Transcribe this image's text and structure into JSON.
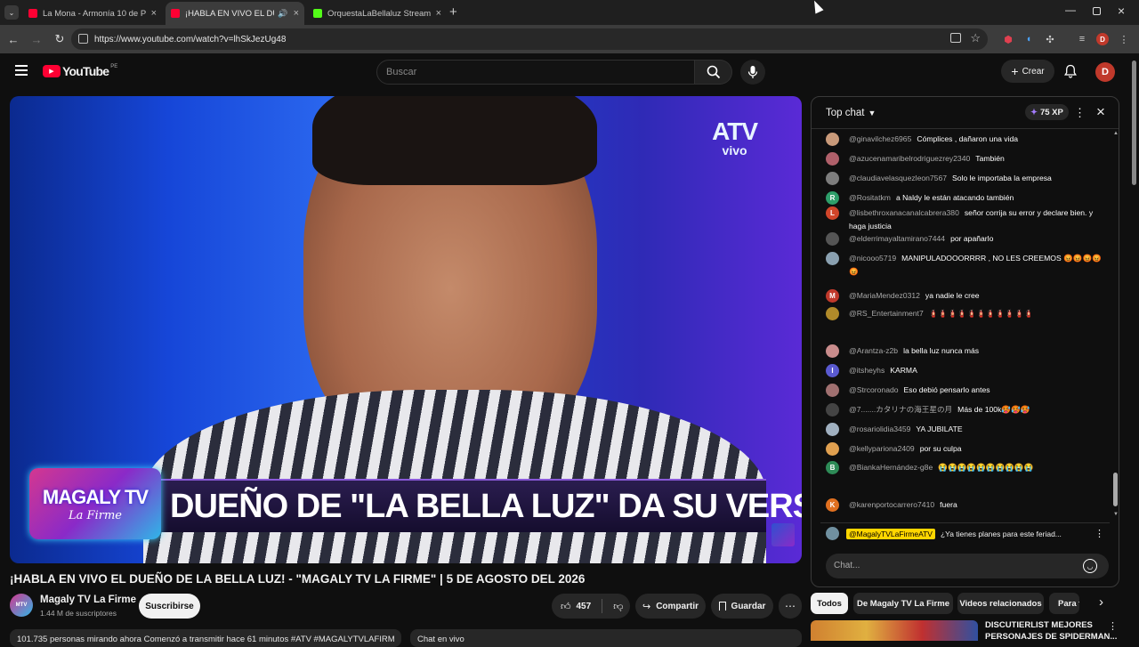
{
  "browser": {
    "tabs": [
      {
        "title": "La Mona - Armonía 10 de Piura",
        "icon_color": "#ff0033",
        "active": false
      },
      {
        "title": "¡HABLA EN VIVO EL DUEÑO",
        "icon_color": "#ff0033",
        "active": true
      },
      {
        "title": "OrquestaLaBellaluz Stream - W",
        "icon_color": "#53fc18",
        "active": false
      }
    ],
    "url": "https://www.youtube.com/watch?v=lhSkJezUg48",
    "profile_initial": "D"
  },
  "youtube": {
    "logo_text": "YouTube",
    "logo_country": "PE",
    "search_placeholder": "Buscar",
    "create_label": "Crear",
    "user_initial": "D"
  },
  "video": {
    "channel_logo": {
      "line1": "ATV",
      "line2": "vivo"
    },
    "show_badge": {
      "line1": "MAGALY TV",
      "line2": "La Firme"
    },
    "lower_third": "DUEÑO DE \"LA BELLA LUZ\" DA SU VERSIÓN",
    "title": "¡HABLA EN VIVO EL DUEÑO DE LA BELLA LUZ! - \"MAGALY TV LA FIRME\" | 5 DE AGOSTO DEL 2026",
    "channel_name": "Magaly TV La Firme",
    "subscribers": "1.44 M de suscriptores",
    "subscribe_label": "Suscribirse",
    "likes": "457",
    "share_label": "Compartir",
    "save_label": "Guardar",
    "description_snippet": "101.735 personas mirando ahora  Comenzó a transmitir hace 61 minutos  #ATV #MAGALYTVLAFIRM",
    "chat_replay_label": "Chat en vivo"
  },
  "chat": {
    "mode": "Top chat",
    "xp": "75 XP",
    "messages": [
      {
        "author": "@ginavilchez6965",
        "text": "Cómplices , dañaron una vida",
        "color": "#c99a7a",
        "initial": ""
      },
      {
        "author": "@azucenamaribelrodriguezrey2340",
        "text": "También",
        "color": "#b0606a",
        "initial": ""
      },
      {
        "author": "@claudiavelasquezleon7567",
        "text": "Solo le importaba la empresa",
        "color": "#7d7d7d",
        "initial": ""
      },
      {
        "author": "@Rositatkm",
        "text": "a Naldy le están atacando también",
        "color": "#2e9e6a",
        "initial": "R"
      },
      {
        "author": "@lisbethroxanacanalcabrera380",
        "text": "señor corrija su error y declare bien. y haga justicia",
        "color": "#d0452a",
        "initial": "L"
      },
      {
        "author": "@elderrimayaltamirano7444",
        "text": "por apañarlo",
        "color": "#555555",
        "initial": ""
      },
      {
        "author": "@nicooo5719",
        "text": "MANIPULADOOORRRR , NO LES CREEMOS 😡😡😡😡😡",
        "color": "#8aa0b0",
        "initial": ""
      },
      {
        "author": "@MariaMendez0312",
        "text": "ya nadie le cree",
        "color": "#c0392b",
        "initial": "M"
      },
      {
        "author": "@RS_Entertainment7",
        "text": "🧯🧯🧯🧯🧯🧯🧯🧯🧯🧯🧯",
        "color": "#b08a2a",
        "initial": ""
      },
      {
        "author": "@Arantza-z2b",
        "text": "la bella luz nunca más",
        "color": "#c98c8c",
        "initial": ""
      },
      {
        "author": "@itsheyhs",
        "text": "KARMA",
        "color": "#5a5ad0",
        "initial": "I"
      },
      {
        "author": "@Strcoronado",
        "text": "Eso debió pensarlo antes",
        "color": "#a07070",
        "initial": ""
      },
      {
        "author": "@7.......カタリナの海王星の月",
        "text": "Más de 100k🥵🥵🥵",
        "color": "#444444",
        "initial": ""
      },
      {
        "author": "@rosariolidia3459",
        "text": "YA JUBILATE",
        "color": "#a0b0c0",
        "initial": ""
      },
      {
        "author": "@kellypariona2409",
        "text": "por su culpa",
        "color": "#e0a050",
        "initial": ""
      },
      {
        "author": "@BiankaHernández-g8e",
        "text": "😭😭😭😭😭😭😭😭😭😭",
        "color": "#2e8b57",
        "initial": "B"
      },
      {
        "author": "@karenportocarrero7410",
        "text": "fuera",
        "color": "#e07020",
        "initial": "K"
      }
    ],
    "pinned_author": "@MagalyTVLaFirmeATV",
    "pinned_text": "¿Ya tienes planes para este feriad...",
    "input_placeholder": "Chat..."
  },
  "chips": [
    "Todos",
    "De Magaly TV La Firme",
    "Videos relacionados",
    "Para ti"
  ],
  "recommendation": {
    "title_line1": "DISCUTIERLIST MEJORES",
    "title_line2": "PERSONAJES DE SPIDERMAN..."
  },
  "colors": {
    "brand_red": "#ff0033",
    "badge_yellow": "#ffd600",
    "background": "#0f0f0f"
  }
}
